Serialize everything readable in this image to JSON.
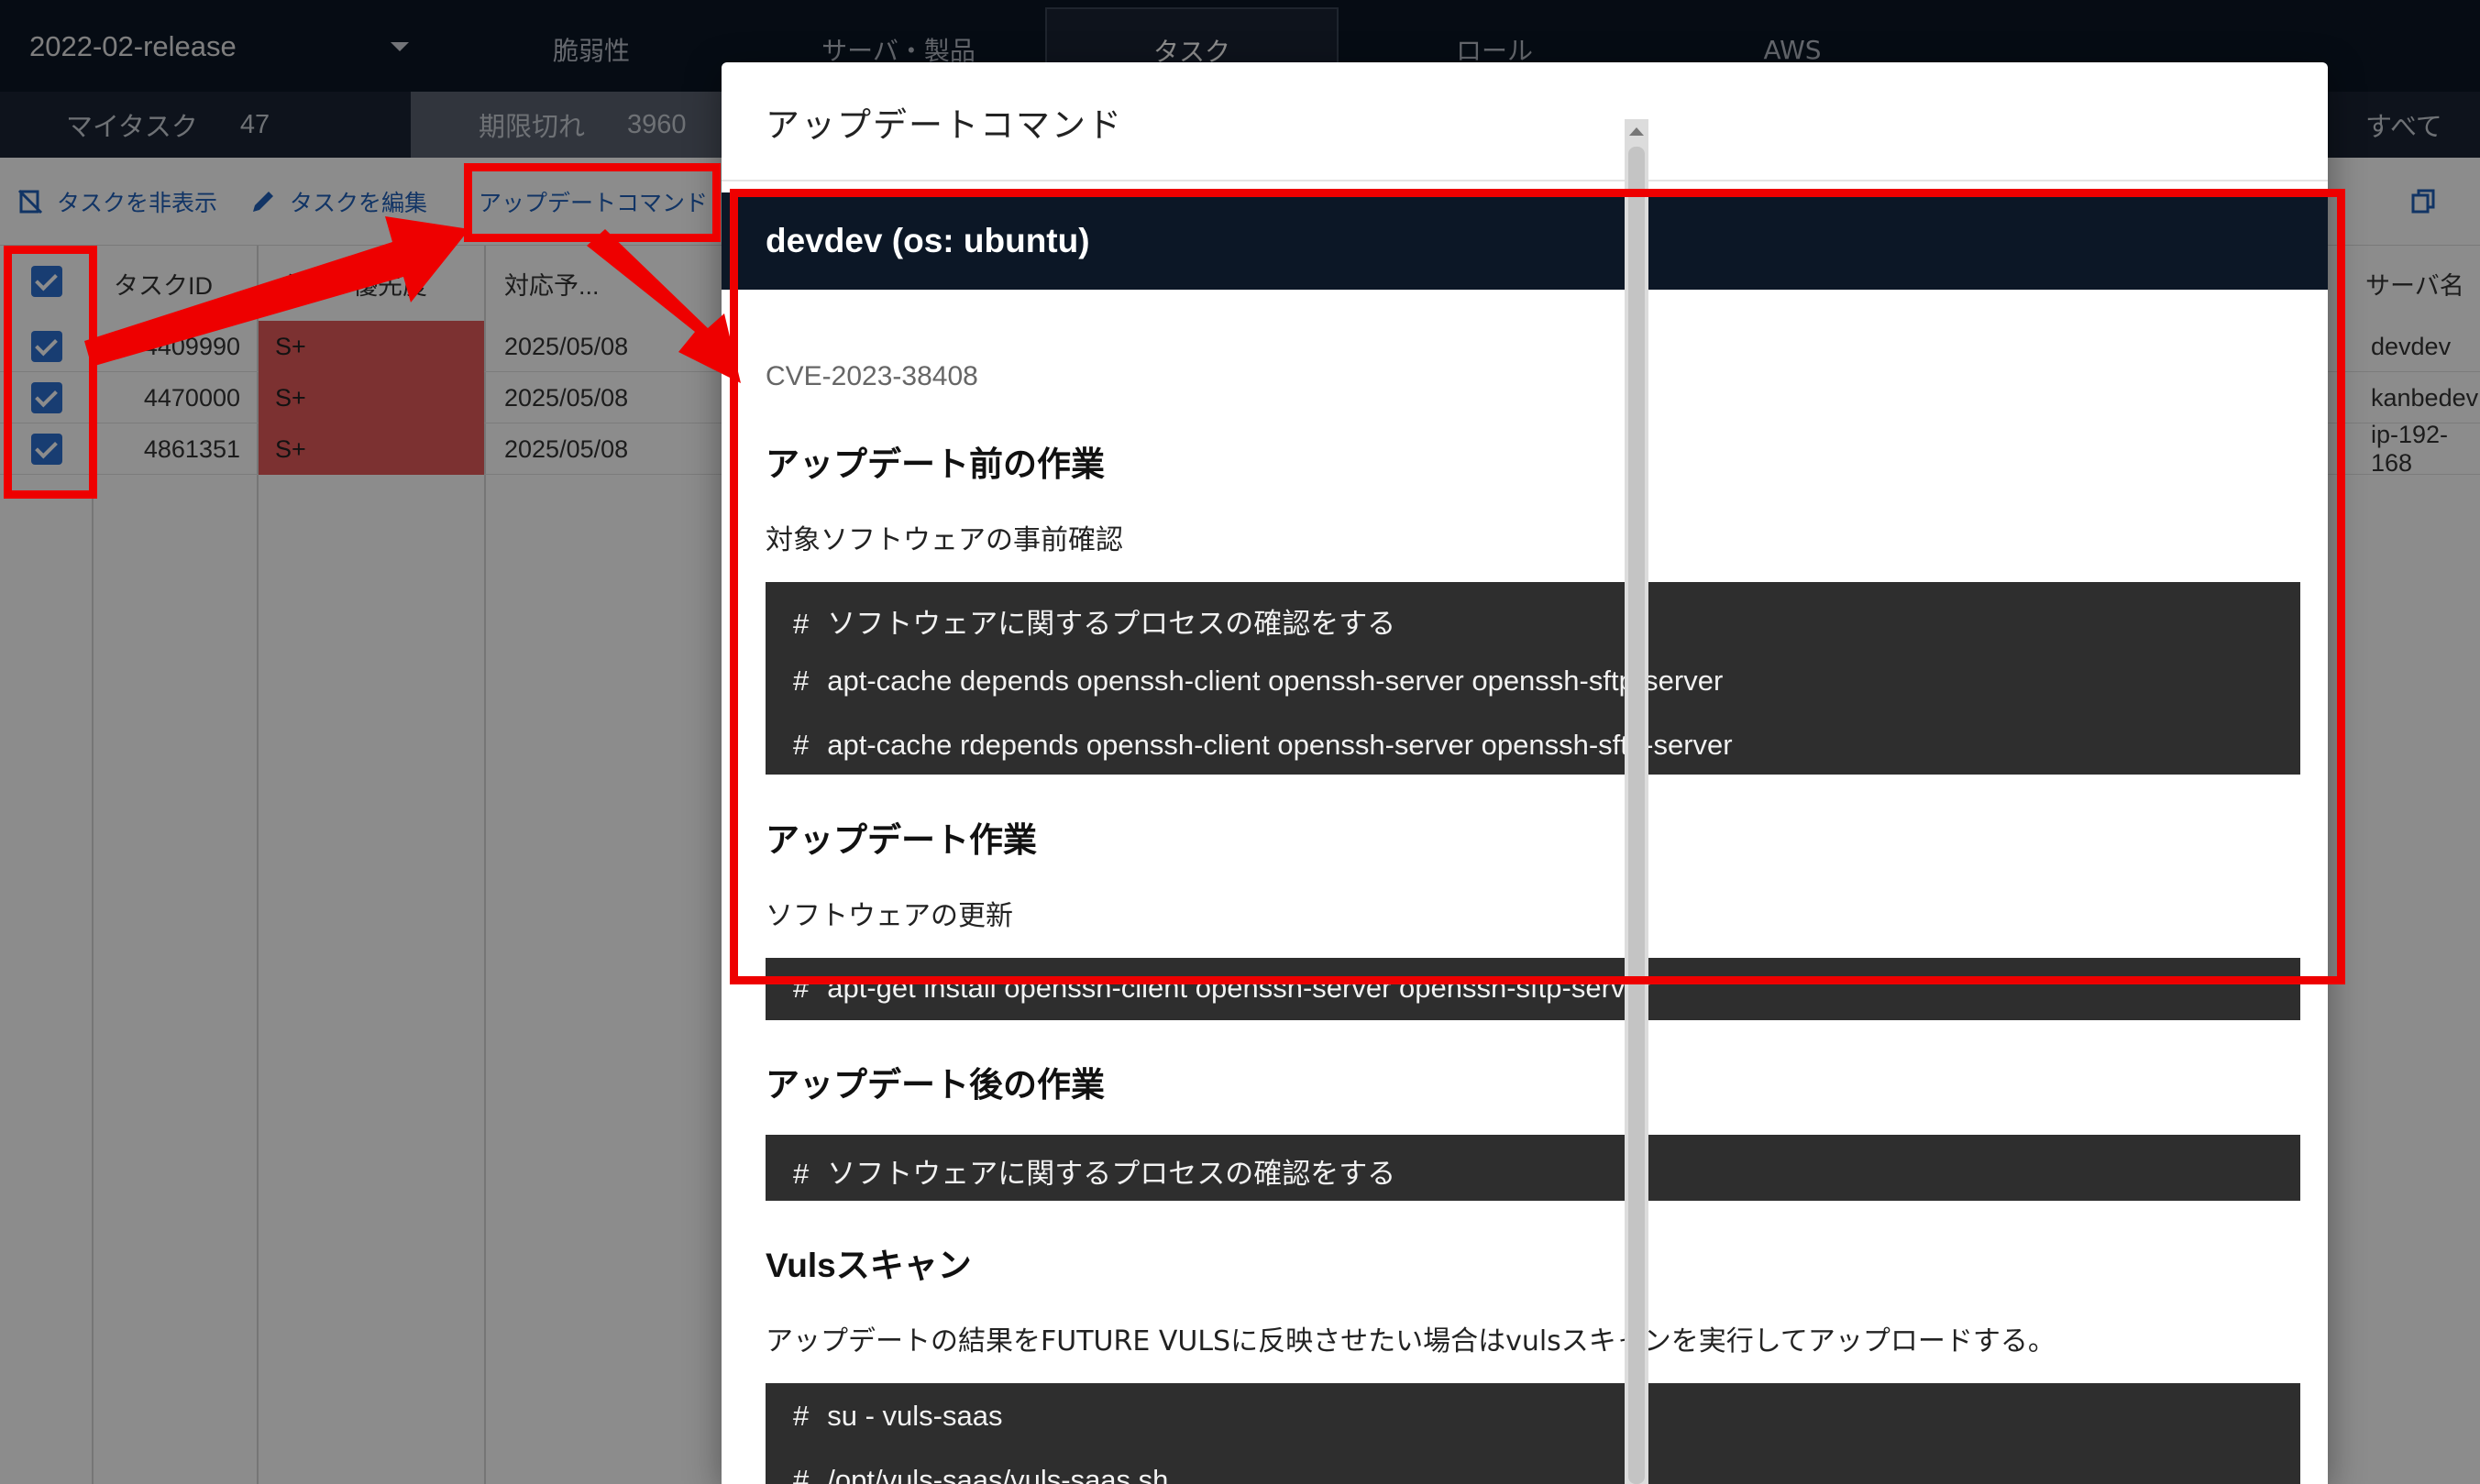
{
  "header": {
    "project": "2022-02-release",
    "tabs": [
      {
        "label": "脆弱性",
        "active": false
      },
      {
        "label": "サーバ・製品",
        "active": false
      },
      {
        "label": "タスク",
        "active": true
      },
      {
        "label": "ロール",
        "active": false
      },
      {
        "label": "AWS",
        "active": false
      }
    ]
  },
  "subtabs": {
    "my_tasks": {
      "label": "マイタスク",
      "count": "47"
    },
    "overdue": {
      "label": "期限切れ",
      "count": "3960"
    },
    "all": {
      "label": "すべて"
    }
  },
  "toolbar": {
    "hide_label": "タスクを非表示",
    "edit_label": "タスクを編集",
    "update_cmd_label": "アップデートコマンド"
  },
  "grid": {
    "columns": {
      "task_id": "タスクID",
      "priority": "タスク優先度",
      "due": "対応予...",
      "server": "サーバ名"
    },
    "rows": [
      {
        "task_id": "4409990",
        "priority": "S+",
        "due": "2025/05/08",
        "server": "devdev"
      },
      {
        "task_id": "4470000",
        "priority": "S+",
        "due": "2025/05/08",
        "server": "kanbedev"
      },
      {
        "task_id": "4861351",
        "priority": "S+",
        "due": "2025/05/08",
        "server": "ip-192-168"
      }
    ]
  },
  "modal": {
    "title": "アップデートコマンド",
    "host": "devdev (os: ubuntu)",
    "cve": "CVE-2023-38408",
    "pre": {
      "heading": "アップデート前の作業",
      "desc": "対象ソフトウェアの事前確認",
      "lines": [
        "ソフトウェアに関するプロセスの確認をする",
        "apt-cache depends openssh-client openssh-server openssh-sftp-server",
        "apt-cache rdepends openssh-client openssh-server openssh-sftp-server"
      ]
    },
    "update": {
      "heading": "アップデート作業",
      "desc": "ソフトウェアの更新",
      "lines": [
        "apt-get install openssh-client openssh-server openssh-sftp-server"
      ]
    },
    "post": {
      "heading": "アップデート後の作業",
      "lines": [
        "ソフトウェアに関するプロセスの確認をする"
      ]
    },
    "vuls": {
      "heading": "Vulsスキャン",
      "desc": "アップデートの結果をFUTURE VULSに反映させたい場合はvulsスキャンを実行してアップロードする。",
      "lines": [
        "su - vuls-saas",
        "/opt/vuls-saas/vuls-saas.sh"
      ]
    },
    "prompt": "#"
  },
  "colors": {
    "nav_bg": "#0c1726",
    "accent": "#2d6fcf",
    "priority_bg": "#e25a5a",
    "code_bg": "#2e2e2e",
    "annotation": "#ee0000"
  }
}
